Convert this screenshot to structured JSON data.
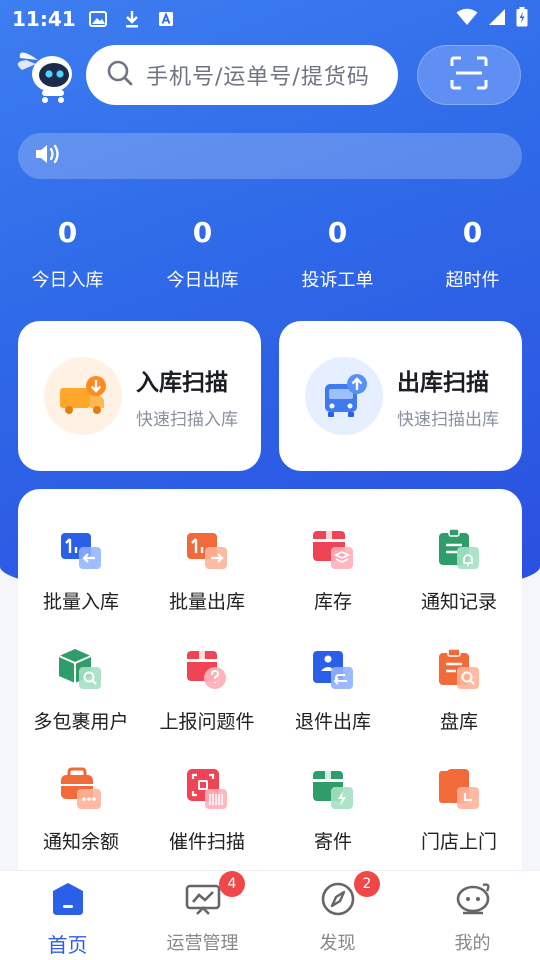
{
  "status_bar": {
    "time": "11:41"
  },
  "search": {
    "placeholder": "手机号/运单号/提货码"
  },
  "notice": {
    "text": ""
  },
  "stats": [
    {
      "value": "0",
      "label": "今日入库"
    },
    {
      "value": "0",
      "label": "今日出库"
    },
    {
      "value": "0",
      "label": "投诉工单"
    },
    {
      "value": "0",
      "label": "超时件"
    }
  ],
  "scan_cards": [
    {
      "title": "入库扫描",
      "subtitle": "快速扫描入库"
    },
    {
      "title": "出库扫描",
      "subtitle": "快速扫描出库"
    }
  ],
  "grid": [
    {
      "label": "批量入库",
      "icon": "batch-in-icon"
    },
    {
      "label": "批量出库",
      "icon": "batch-out-icon"
    },
    {
      "label": "库存",
      "icon": "inventory-icon"
    },
    {
      "label": "通知记录",
      "icon": "notice-record-icon"
    },
    {
      "label": "多包裹用户",
      "icon": "multi-parcel-icon"
    },
    {
      "label": "上报问题件",
      "icon": "report-problem-icon"
    },
    {
      "label": "退件出库",
      "icon": "return-out-icon"
    },
    {
      "label": "盘库",
      "icon": "stocktake-icon"
    },
    {
      "label": "通知余额",
      "icon": "notice-balance-icon"
    },
    {
      "label": "催件扫描",
      "icon": "urge-scan-icon"
    },
    {
      "label": "寄件",
      "icon": "send-parcel-icon"
    },
    {
      "label": "门店上门",
      "icon": "store-pickup-icon"
    }
  ],
  "tabs": [
    {
      "label": "首页",
      "badge": ""
    },
    {
      "label": "运营管理",
      "badge": "4"
    },
    {
      "label": "发现",
      "badge": "2"
    },
    {
      "label": "我的",
      "badge": ""
    }
  ],
  "colors": {
    "primary": "#2f6ae8",
    "badge": "#f04848"
  }
}
